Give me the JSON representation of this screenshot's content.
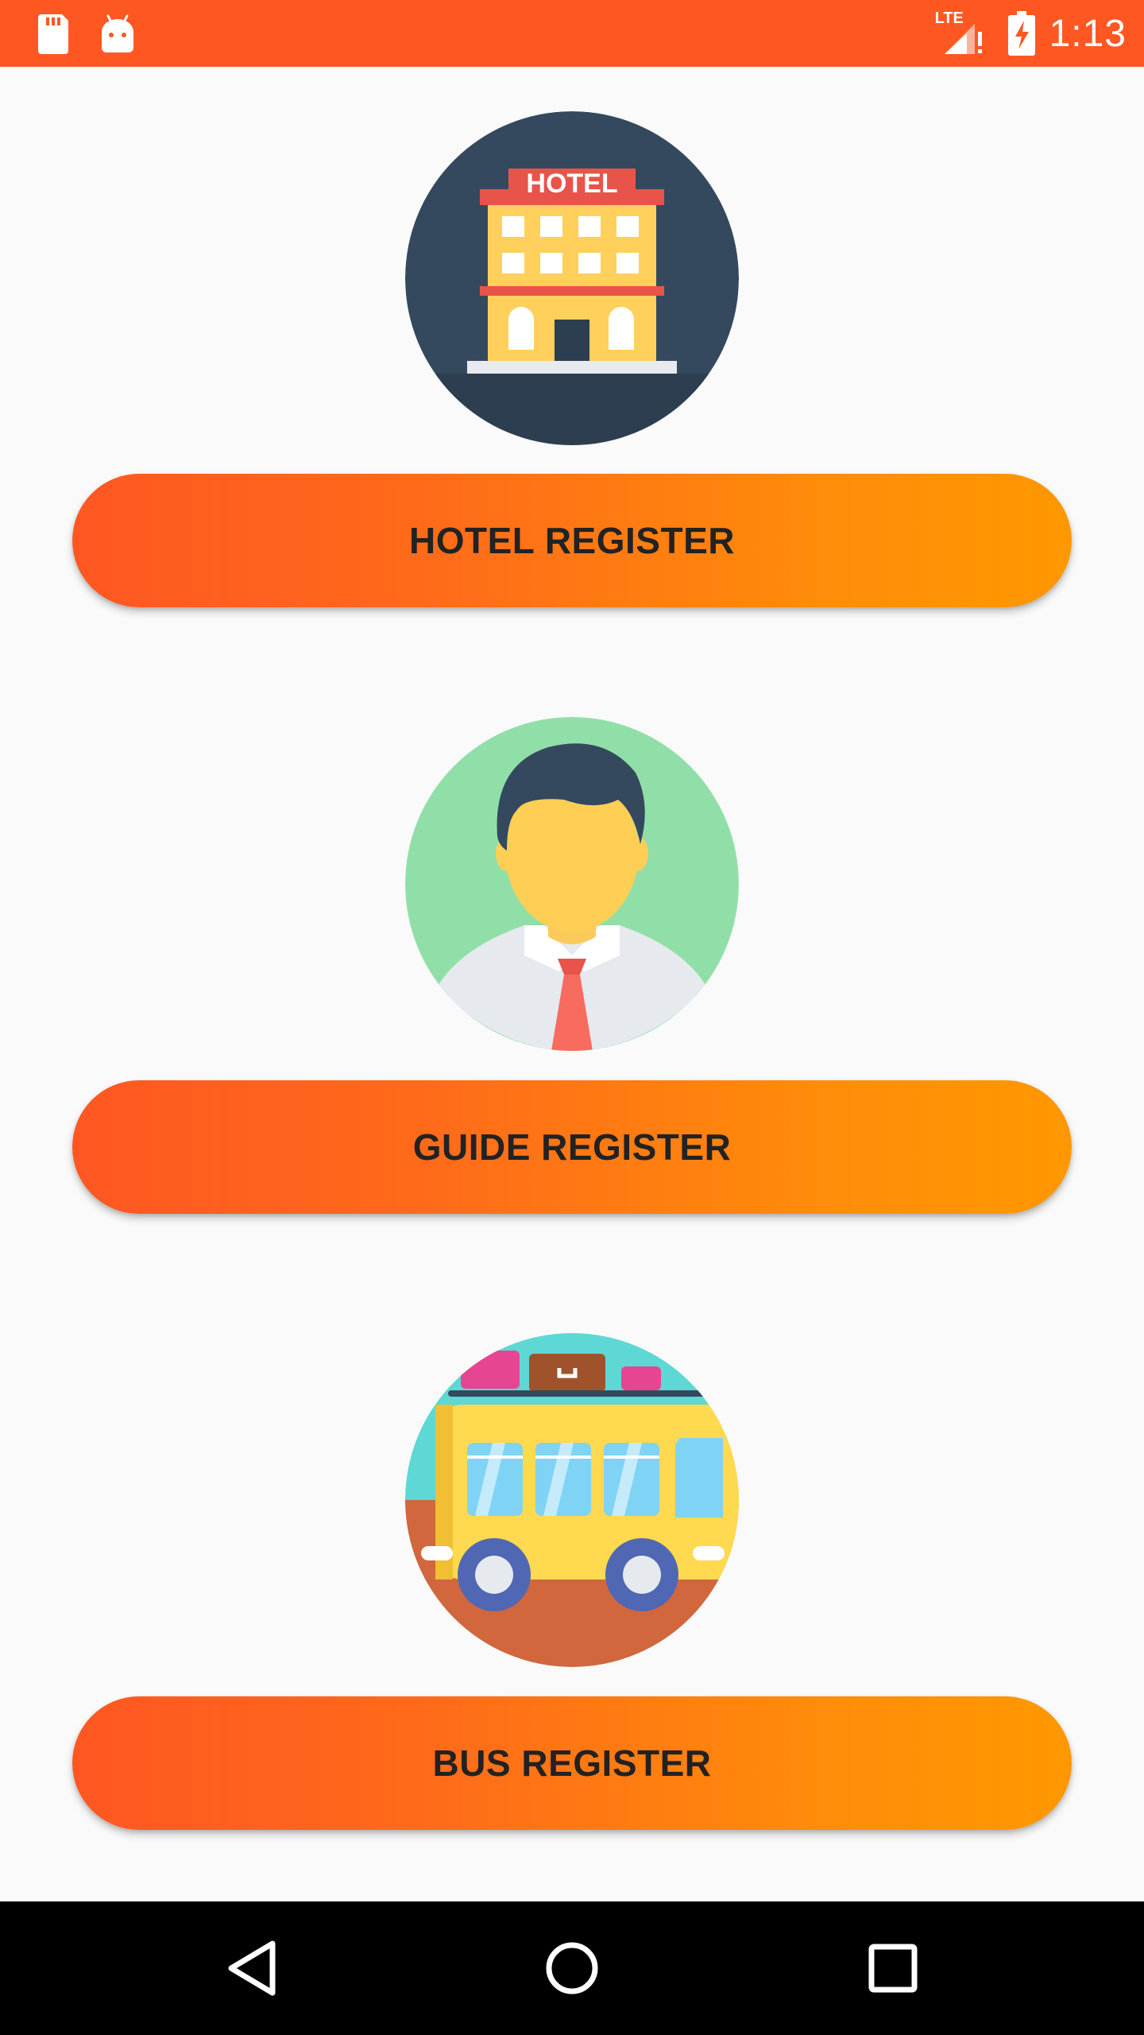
{
  "status_bar": {
    "time": "1:13",
    "network_label": "LTE",
    "background_color": "#ff5722",
    "icons": [
      "sd-card-icon",
      "android-icon",
      "lte-signal-icon",
      "battery-charging-icon"
    ]
  },
  "hotel": {
    "sign_text": "HOTEL",
    "button_label": "HOTEL REGISTER",
    "icon": "hotel-building-icon"
  },
  "guide": {
    "button_label": "GUIDE REGISTER",
    "icon": "guide-person-icon"
  },
  "bus": {
    "button_label": "BUS REGISTER",
    "icon": "bus-icon"
  },
  "theme": {
    "button_gradient_start": "#ff5722",
    "button_gradient_end": "#ff9800",
    "button_text_color": "#222222",
    "page_background": "#fafafa"
  },
  "nav_bar": {
    "icons": [
      "back-icon",
      "home-icon",
      "recents-icon"
    ]
  }
}
